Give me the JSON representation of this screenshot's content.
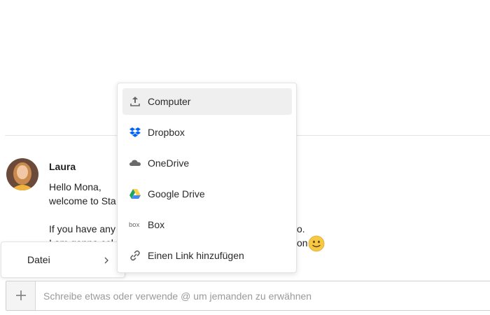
{
  "message": {
    "sender": "Laura",
    "lines": [
      "Hello Mona,",
      "welcome to Sta",
      "",
      "If you have any",
      "I am gonna col"
    ],
    "lines_tail": [
      "o.",
      "on"
    ],
    "avatar_icon": "user-avatar-photo",
    "emoji_icon": "slightly-smiling-face"
  },
  "left_menu": {
    "items": [
      {
        "label": "Datei",
        "icon": "chevron-right-icon"
      }
    ]
  },
  "dropdown": {
    "items": [
      {
        "label": "Computer",
        "icon": "upload-icon",
        "active": true
      },
      {
        "label": "Dropbox",
        "icon": "dropbox-icon",
        "active": false
      },
      {
        "label": "OneDrive",
        "icon": "onedrive-icon",
        "active": false
      },
      {
        "label": "Google Drive",
        "icon": "google-drive-icon",
        "active": false
      },
      {
        "label": "Box",
        "icon": "box-icon",
        "active": false
      },
      {
        "label": "Einen Link hinzufügen",
        "icon": "link-icon",
        "active": false
      }
    ]
  },
  "composer": {
    "add_icon": "plus-icon",
    "placeholder": "Schreibe etwas oder verwende @ um jemanden zu erwähnen",
    "value": ""
  },
  "colors": {
    "dropbox": "#0061fe",
    "google_drive_green": "#1fa463",
    "google_drive_yellow": "#ffd04b",
    "google_drive_blue": "#4688f4",
    "emoji": "#f7c844",
    "active_item_bg": "#efefef"
  }
}
